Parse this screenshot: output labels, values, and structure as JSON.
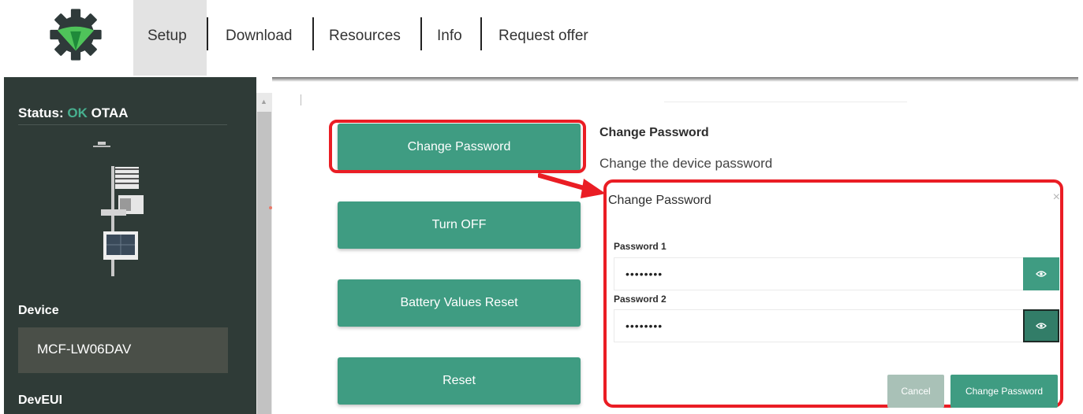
{
  "nav": {
    "items": [
      {
        "label": "Setup",
        "active": true
      },
      {
        "label": "Download"
      },
      {
        "label": "Resources"
      },
      {
        "label": "Info"
      },
      {
        "label": "Request offer"
      }
    ]
  },
  "sidebar": {
    "status_label": "Status:",
    "status_ok": "OK",
    "status_mode": "OTAA",
    "device_label": "Device",
    "device_value": "MCF-LW06DAV",
    "deveui_label": "DevEUI"
  },
  "actions": {
    "change_password": "Change Password",
    "turn_off": "Turn OFF",
    "battery_reset": "Battery Values Reset",
    "reset": "Reset"
  },
  "detail": {
    "title": "Change Password",
    "description": "Change the device password"
  },
  "dialog": {
    "title": "Change Password",
    "close": "×",
    "password1_label": "Password 1",
    "password1_value": "••••••••",
    "password2_label": "Password 2",
    "password2_value": "••••••••",
    "cancel": "Cancel",
    "submit": "Change Password"
  },
  "colors": {
    "accent": "#3f9c82",
    "sidebar": "#2f3b37",
    "highlight": "#ea1d24",
    "status_ok": "#47b08f"
  }
}
